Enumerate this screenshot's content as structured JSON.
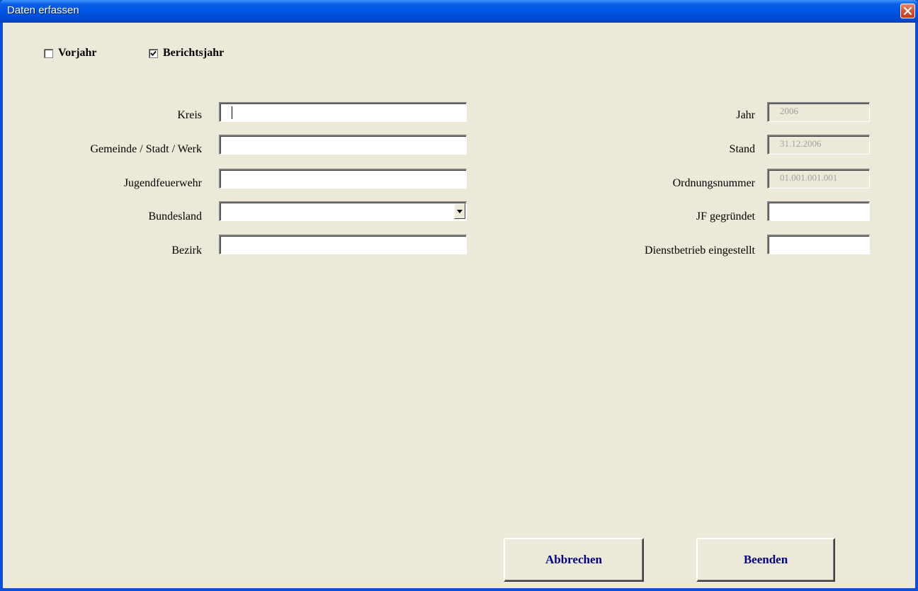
{
  "window": {
    "title": "Daten erfassen"
  },
  "checkboxes": {
    "vorjahr": {
      "label": "Vorjahr",
      "checked": false
    },
    "berichtsjahr": {
      "label": "Berichtsjahr",
      "checked": true
    }
  },
  "left_fields": {
    "kreis": {
      "label": "Kreis",
      "value": ""
    },
    "gemeinde": {
      "label": "Gemeinde / Stadt / Werk",
      "value": ""
    },
    "jugendfeuerwehr": {
      "label": "Jugendfeuerwehr",
      "value": ""
    },
    "bundesland": {
      "label": "Bundesland",
      "value": ""
    },
    "bezirk": {
      "label": "Bezirk",
      "value": ""
    }
  },
  "right_fields": {
    "jahr": {
      "label": "Jahr",
      "value": "2006"
    },
    "stand": {
      "label": "Stand",
      "value": "31.12.2006"
    },
    "ordnungsnummer": {
      "label": "Ordnungsnummer",
      "value": "01.001.001.001"
    },
    "jf_gegruendet": {
      "label": "JF gegründet",
      "value": ""
    },
    "dienstbetrieb": {
      "label": "Dienstbetrieb eingestellt",
      "value": ""
    }
  },
  "buttons": {
    "abbrechen": "Abbrechen",
    "beenden": "Beenden"
  },
  "colors": {
    "titlebar": "#0055e5",
    "dialog_background": "#ece9d8",
    "button_text": "#00008b",
    "close_button": "#d9502f",
    "disabled_text": "#a0a0a0"
  }
}
